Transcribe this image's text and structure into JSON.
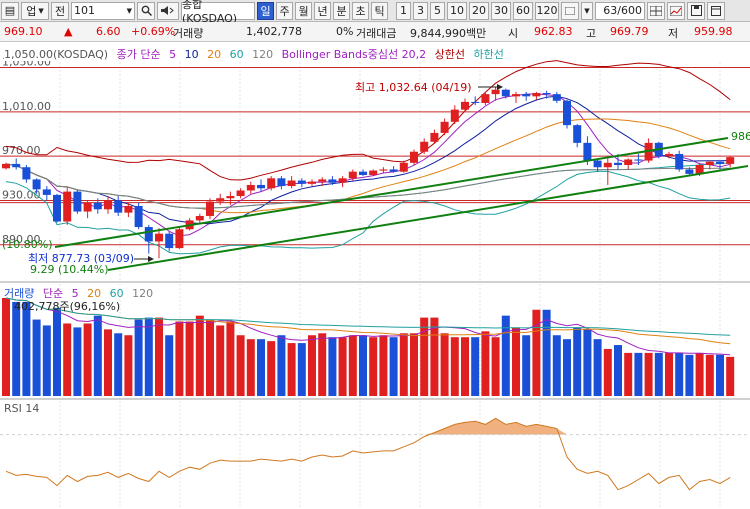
{
  "toolbar": {
    "menu_glyph": "▤",
    "mode_label": "업",
    "prev_label": "전",
    "code": "101",
    "index_name": "종합(KOSDAQ)",
    "period_tabs": [
      "일",
      "주",
      "월",
      "년",
      "분",
      "초",
      "틱"
    ],
    "active_period": "일",
    "interval_tabs": [
      "1",
      "3",
      "5",
      "10",
      "20",
      "30",
      "60",
      "120"
    ],
    "page_counter": "63/600"
  },
  "quote": {
    "price": "969.10",
    "change_arrow": "▲",
    "change": "6.60",
    "change_pct": "+0.69%",
    "volume_label": "거래량",
    "volume": "1,402,778",
    "volume_ratio": "0%",
    "turnover_label": "거래대금",
    "turnover": "9,844,990백만",
    "si_label": "시",
    "open": "962.83",
    "go_label": "고",
    "high": "969.79",
    "jeo_label": "저",
    "low": "959.98"
  },
  "price_legend": {
    "title": "1,050.00(KOSDAQ)",
    "ma_label": "종가 단순",
    "ma_periods": [
      "5",
      "10",
      "20",
      "60",
      "120"
    ],
    "bb_label": "Bollinger Bands중심선 20,2",
    "upper_label": "상한선",
    "lower_label": "하한선"
  },
  "volume_legend": {
    "title": "거래량",
    "ma_label": "단순",
    "ma_periods": [
      "5",
      "20",
      "60",
      "120"
    ],
    "current": "402,778주(96,16%)"
  },
  "rsi_legend": {
    "title": "RSI 14"
  },
  "colors": {
    "up": "#e02020",
    "down": "#1a50d8",
    "ma5": "#a020c0",
    "ma10": "#1020a0",
    "ma20": "#e08010",
    "ma60": "#20a0a0",
    "ma120": "#808080",
    "bb_band": "#b00000",
    "trendline": "#108010",
    "rsi": "#d07820",
    "rsi_fill": "#f0b080"
  },
  "chart_data": [
    {
      "type": "candlestick",
      "y_axis_labels": [
        "1,050.00",
        "1,010.00",
        "970.00",
        "930.00",
        "890.00"
      ],
      "ylim": [
        860,
        1055
      ],
      "annotations": [
        {
          "text": "최고 1,032.64 (04/19)",
          "value": 1032.64
        },
        {
          "text": "최저 877.73 (03/09)",
          "value": 877.73
        },
        {
          "text": "9.29 (10.44%)"
        },
        {
          "text": "(10.80%)"
        },
        {
          "text": "986",
          "value": 986
        }
      ],
      "candles": [
        [
          959,
          964,
          958,
          963
        ],
        [
          963,
          968,
          958,
          960
        ],
        [
          960,
          962,
          946,
          949
        ],
        [
          949,
          950,
          936,
          940
        ],
        [
          940,
          943,
          930,
          935
        ],
        [
          935,
          936,
          910,
          911
        ],
        [
          911,
          942,
          908,
          938
        ],
        [
          938,
          940,
          918,
          920
        ],
        [
          920,
          930,
          914,
          928
        ],
        [
          928,
          932,
          918,
          922
        ],
        [
          922,
          934,
          918,
          930
        ],
        [
          930,
          934,
          916,
          919
        ],
        [
          919,
          928,
          915,
          925
        ],
        [
          925,
          928,
          904,
          906
        ],
        [
          906,
          908,
          882,
          893
        ],
        [
          893,
          905,
          877.73,
          900
        ],
        [
          900,
          902,
          884,
          887
        ],
        [
          887,
          906,
          886,
          904
        ],
        [
          904,
          914,
          903,
          912
        ],
        [
          912,
          918,
          909,
          916
        ],
        [
          916,
          932,
          913,
          929
        ],
        [
          929,
          936,
          926,
          932
        ],
        [
          932,
          938,
          926,
          934
        ],
        [
          934,
          941,
          932,
          939
        ],
        [
          939,
          947,
          936,
          944
        ],
        [
          944,
          949,
          938,
          941
        ],
        [
          941,
          952,
          939,
          950
        ],
        [
          950,
          952,
          940,
          943
        ],
        [
          943,
          952,
          941,
          948
        ],
        [
          948,
          950,
          942,
          945
        ],
        [
          945,
          949,
          943,
          947
        ],
        [
          947,
          951,
          943,
          949
        ],
        [
          949,
          952,
          944,
          946
        ],
        [
          946,
          952,
          942,
          950
        ],
        [
          950,
          958,
          948,
          956
        ],
        [
          956,
          958,
          952,
          953
        ],
        [
          953,
          958,
          952,
          957
        ],
        [
          957,
          960,
          955,
          958
        ],
        [
          958,
          961,
          955,
          956
        ],
        [
          956,
          966,
          955,
          964
        ],
        [
          964,
          976,
          962,
          974
        ],
        [
          974,
          986,
          972,
          983
        ],
        [
          983,
          994,
          981,
          991
        ],
        [
          991,
          1004,
          989,
          1001
        ],
        [
          1001,
          1016,
          999,
          1012
        ],
        [
          1012,
          1022,
          1010,
          1019
        ],
        [
          1019,
          1024,
          1016,
          1018
        ],
        [
          1018,
          1028,
          1016,
          1026
        ],
        [
          1026,
          1032.64,
          1020,
          1030
        ],
        [
          1030,
          1031,
          1022,
          1024
        ],
        [
          1024,
          1028,
          1018,
          1026
        ],
        [
          1026,
          1028,
          1020,
          1024
        ],
        [
          1024,
          1028,
          1021,
          1027
        ],
        [
          1027,
          1029,
          1022,
          1026
        ],
        [
          1026,
          1028,
          1018,
          1020
        ],
        [
          1020,
          1021,
          995,
          998
        ],
        [
          998,
          999,
          978,
          982
        ],
        [
          982,
          988,
          962,
          966
        ],
        [
          966,
          968,
          956,
          960
        ],
        [
          960,
          968,
          944,
          964
        ],
        [
          964,
          972,
          958,
          962
        ],
        [
          962,
          968,
          958,
          967
        ],
        [
          967,
          972,
          962,
          966
        ],
        [
          966,
          986,
          964,
          982
        ],
        [
          982,
          983,
          968,
          970
        ],
        [
          970,
          974,
          968,
          972
        ],
        [
          972,
          975,
          956,
          958
        ],
        [
          958,
          960,
          952,
          954
        ],
        [
          954,
          964,
          952,
          962
        ],
        [
          962,
          966,
          958,
          965
        ],
        [
          965,
          966,
          958,
          963
        ],
        [
          963,
          970,
          960,
          969.1
        ]
      ]
    },
    {
      "type": "bar",
      "name": "거래량",
      "values": [
        1.0,
        0.96,
        0.96,
        0.78,
        0.72,
        0.9,
        0.74,
        0.7,
        0.74,
        0.82,
        0.68,
        0.64,
        0.62,
        0.78,
        0.8,
        0.8,
        0.62,
        0.76,
        0.76,
        0.82,
        0.78,
        0.72,
        0.76,
        0.62,
        0.58,
        0.58,
        0.56,
        0.62,
        0.54,
        0.54,
        0.62,
        0.64,
        0.6,
        0.6,
        0.62,
        0.62,
        0.6,
        0.62,
        0.6,
        0.64,
        0.64,
        0.8,
        0.8,
        0.64,
        0.6,
        0.6,
        0.6,
        0.66,
        0.6,
        0.82,
        0.7,
        0.62,
        0.88,
        0.88,
        0.62,
        0.58,
        0.7,
        0.68,
        0.58,
        0.48,
        0.52,
        0.44,
        0.44,
        0.44,
        0.44,
        0.44,
        0.44,
        0.42,
        0.44,
        0.42,
        0.42,
        0.4
      ]
    },
    {
      "type": "line",
      "name": "RSI 14",
      "values": [
        34,
        30,
        31,
        29,
        28,
        20,
        30,
        24,
        29,
        30,
        33,
        28,
        32,
        27,
        24,
        34,
        28,
        34,
        38,
        36,
        42,
        45,
        44,
        44,
        44,
        46,
        45,
        44,
        46,
        44,
        48,
        50,
        48,
        49,
        54,
        52,
        53,
        54,
        54,
        58,
        62,
        68,
        72,
        76,
        80,
        82,
        83,
        80,
        86,
        80,
        82,
        78,
        80,
        78,
        76,
        48,
        36,
        32,
        34,
        30,
        16,
        20,
        26,
        32,
        22,
        28,
        30,
        16,
        24,
        26,
        22,
        28
      ]
    }
  ]
}
